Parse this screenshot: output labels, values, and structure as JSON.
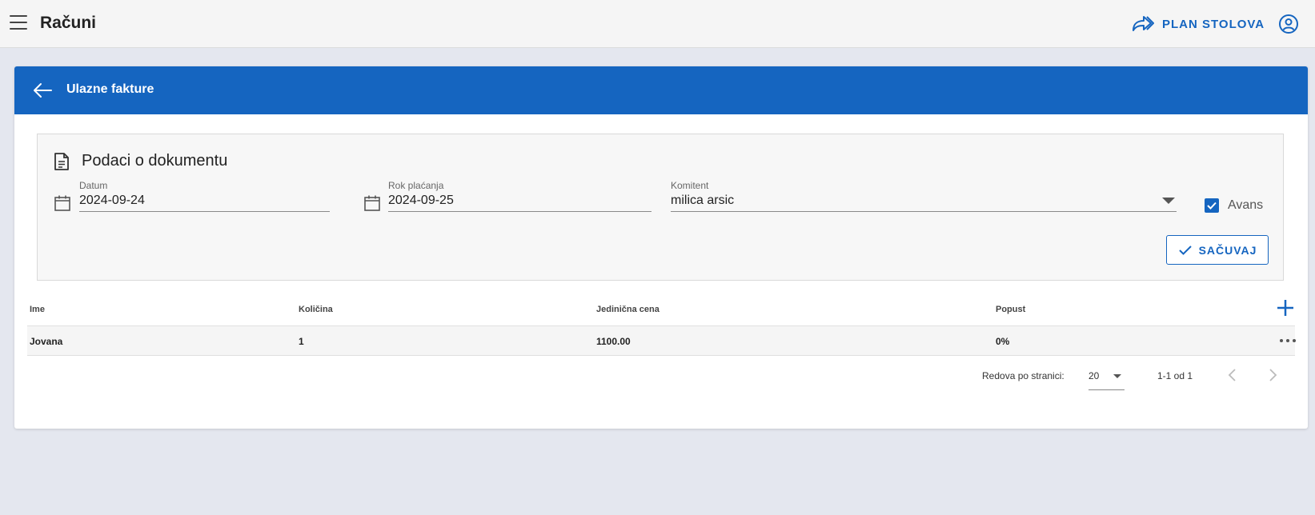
{
  "app": {
    "title": "Računi"
  },
  "topbar": {
    "plan_label": "PLAN STOLOVA"
  },
  "card": {
    "title": "Ulazne fakture"
  },
  "document": {
    "title": "Podaci o dokumentu",
    "datum": {
      "label": "Datum",
      "value": "2024-09-24"
    },
    "rok": {
      "label": "Rok plaćanja",
      "value": "2024-09-25"
    },
    "komitent": {
      "label": "Komitent",
      "value": "milica arsic"
    },
    "avans": {
      "label": "Avans",
      "checked": true
    },
    "save_label": "SAČUVAJ"
  },
  "table": {
    "columns": [
      "Ime",
      "Količina",
      "Jedinična cena",
      "Popust"
    ],
    "rows": [
      [
        "Jovana",
        "1",
        "1100.00",
        "0%"
      ]
    ]
  },
  "pagination": {
    "rows_per_page_label": "Redova po stranici:",
    "rows_per_page": "20",
    "range": "1-1 od 1"
  },
  "colors": {
    "primary": "#1565c0",
    "background": "#e4e7ef"
  }
}
